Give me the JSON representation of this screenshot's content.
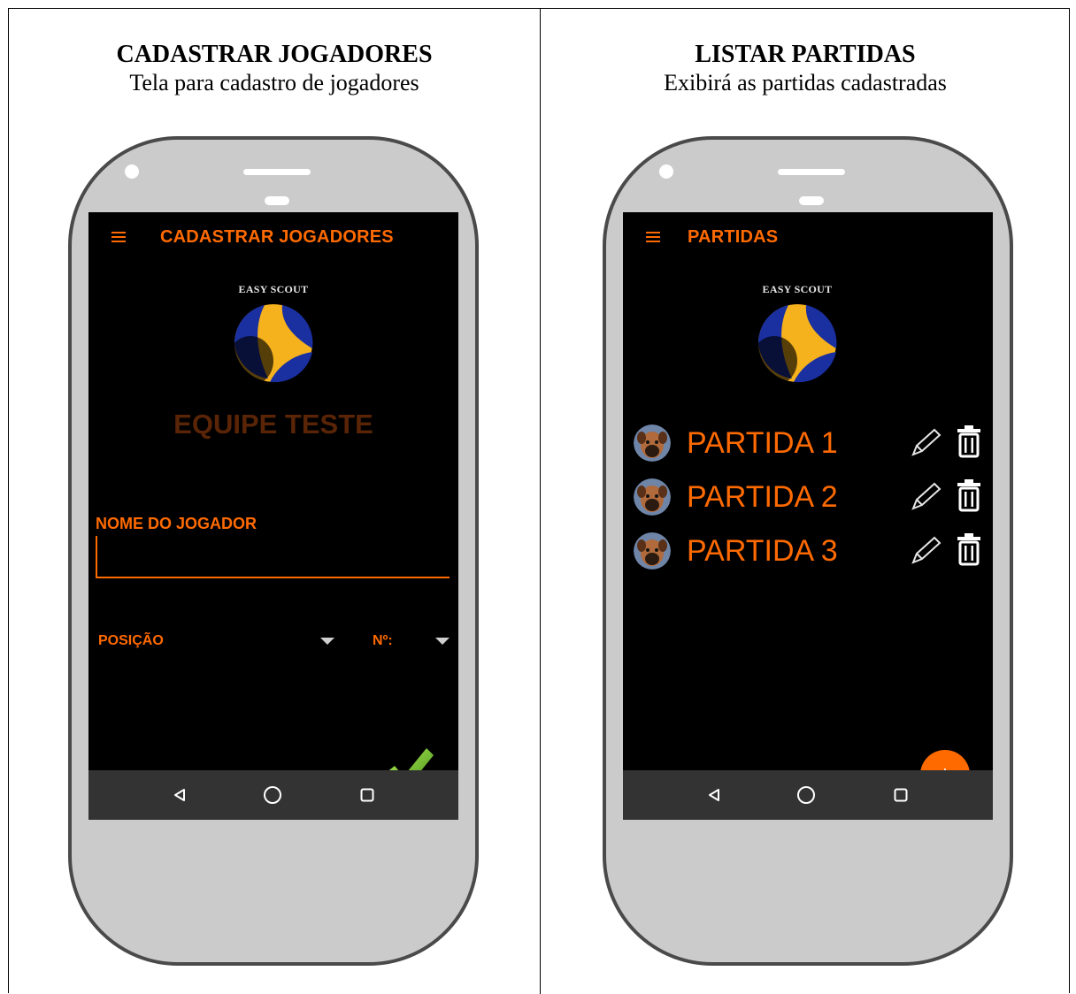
{
  "colors": {
    "accent": "#ff6a00",
    "team_name": "#5a2406",
    "screen_bg": "#000000",
    "navbar_bg": "#333333",
    "phone_body": "#cbcbcb"
  },
  "left_panel": {
    "heading": "CADASTRAR JOGADORES",
    "subheading": "Tela para cadastro de jogadores",
    "app": {
      "title": "CADASTRAR JOGADORES",
      "menu_icon": "hamburger-menu-icon",
      "logo_text": "EASY SCOUT",
      "team_name": "EQUIPE TESTE",
      "player_name_label": "NOME DO JOGADOR",
      "player_name_value": "",
      "position_label": "POSIÇÃO",
      "number_label": "Nº:",
      "confirm_icon": "checkmark-icon"
    }
  },
  "right_panel": {
    "heading": "LISTAR PARTIDAS",
    "subheading": "Exibirá as partidas cadastradas",
    "app": {
      "title": "PARTIDAS",
      "menu_icon": "hamburger-menu-icon",
      "logo_text": "EASY SCOUT",
      "matches": [
        {
          "name": "PARTIDA 1",
          "avatar_icon": "dog-avatar-icon",
          "edit_icon": "pencil-icon",
          "delete_icon": "trash-icon"
        },
        {
          "name": "PARTIDA 2",
          "avatar_icon": "dog-avatar-icon",
          "edit_icon": "pencil-icon",
          "delete_icon": "trash-icon"
        },
        {
          "name": "PARTIDA 3",
          "avatar_icon": "dog-avatar-icon",
          "edit_icon": "pencil-icon",
          "delete_icon": "trash-icon"
        }
      ],
      "fab_label": "+"
    }
  },
  "navbar": {
    "back_icon": "back-triangle-icon",
    "home_icon": "home-circle-icon",
    "recents_icon": "recents-square-icon"
  }
}
